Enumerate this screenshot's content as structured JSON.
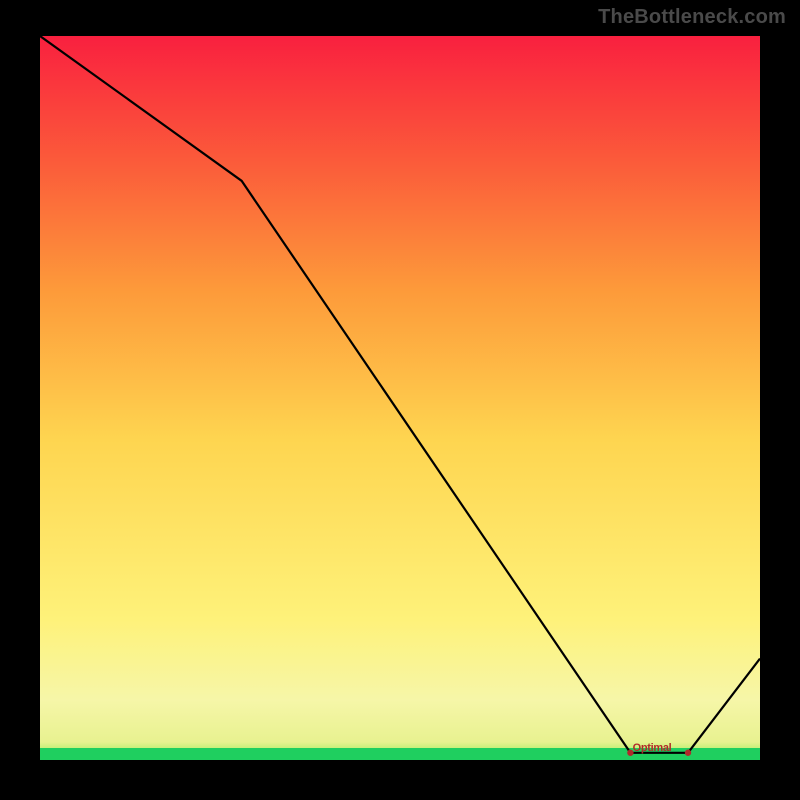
{
  "watermark": "TheBottleneck.com",
  "chart_data": {
    "type": "line",
    "title": "",
    "xlabel": "",
    "ylabel": "",
    "xlim": [
      0,
      100
    ],
    "ylim": [
      0,
      100
    ],
    "x": [
      0,
      28,
      82,
      90,
      100
    ],
    "values": [
      100,
      80,
      1,
      1,
      14
    ],
    "annotation": {
      "label": "Optimal",
      "x": 85,
      "y": 1
    },
    "gradient_stops": [
      {
        "pos": 0.0,
        "color": "#1fcf5f"
      },
      {
        "pos": 0.02,
        "color": "#c8f07a"
      },
      {
        "pos": 0.08,
        "color": "#f6f6a8"
      },
      {
        "pos": 0.2,
        "color": "#fef27a"
      },
      {
        "pos": 0.45,
        "color": "#fed550"
      },
      {
        "pos": 0.65,
        "color": "#fd9a3a"
      },
      {
        "pos": 0.83,
        "color": "#fb5a3a"
      },
      {
        "pos": 1.0,
        "color": "#f9203f"
      }
    ]
  }
}
